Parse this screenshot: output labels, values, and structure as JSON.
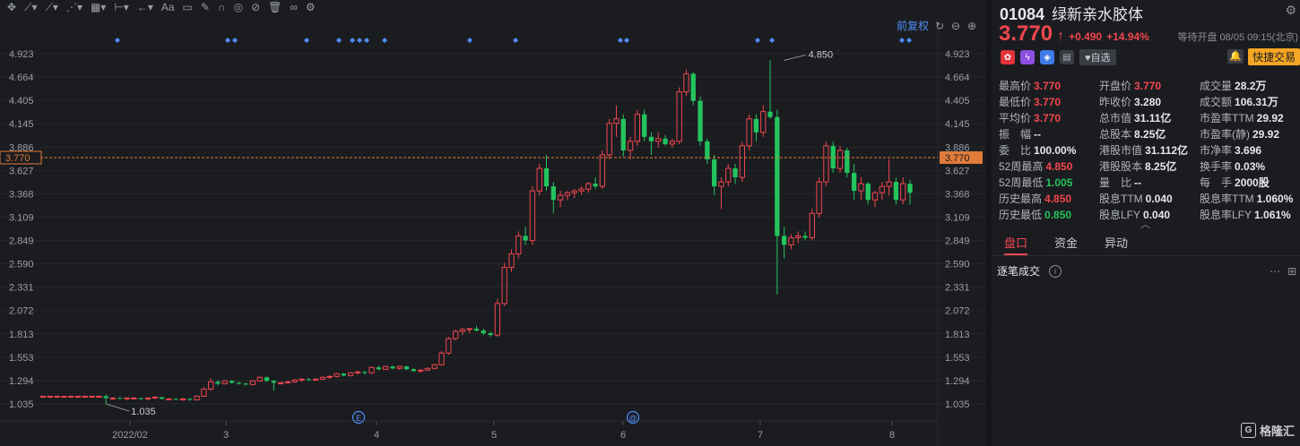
{
  "toolbar": {
    "tools": [
      "cursor-crosshair-icon",
      "line-tool-icon",
      "trend-tool-icon",
      "channel-tool-icon",
      "measure-tool-icon",
      "range-tool-icon",
      "arrow-tool-icon",
      "text-tool-icon",
      "note-tool-icon",
      "pen-tool-icon",
      "magnet-tool-icon",
      "visibility-tool-icon",
      "hide-tool-icon",
      "trash-tool-icon",
      "link-tool-icon",
      "settings-tool-icon"
    ],
    "text_tool_label": "Aa"
  },
  "chart_controls": {
    "adjust_label": "前复权"
  },
  "chart_data": {
    "type": "candlestick",
    "y_ticks": [
      "4.923",
      "4.664",
      "4.405",
      "4.145",
      "3.886",
      "3.627",
      "3.368",
      "3.109",
      "2.849",
      "2.590",
      "2.331",
      "2.072",
      "1.813",
      "1.553",
      "1.294",
      "1.035"
    ],
    "ylim": [
      1.035,
      4.923
    ],
    "x_ticks": [
      "2022/02",
      "3",
      "4",
      "5",
      "6",
      "7",
      "8"
    ],
    "current_price_label": "3.770",
    "high_annotation": "4.850",
    "low_annotation": "1.035",
    "event_markers": [
      "E",
      "@"
    ],
    "candles": [
      [
        1.12,
        1.12,
        1.11,
        1.12
      ],
      [
        1.12,
        1.12,
        1.11,
        1.12
      ],
      [
        1.12,
        1.12,
        1.11,
        1.12
      ],
      [
        1.12,
        1.12,
        1.11,
        1.12
      ],
      [
        1.12,
        1.12,
        1.11,
        1.12
      ],
      [
        1.12,
        1.12,
        1.11,
        1.12
      ],
      [
        1.12,
        1.12,
        1.11,
        1.12
      ],
      [
        1.12,
        1.12,
        1.11,
        1.12
      ],
      [
        1.12,
        1.12,
        1.11,
        1.12
      ],
      [
        1.12,
        1.14,
        1.035,
        1.1
      ],
      [
        1.1,
        1.11,
        1.08,
        1.1
      ],
      [
        1.1,
        1.11,
        1.09,
        1.09
      ],
      [
        1.09,
        1.11,
        1.08,
        1.1
      ],
      [
        1.1,
        1.11,
        1.09,
        1.1
      ],
      [
        1.1,
        1.1,
        1.08,
        1.09
      ],
      [
        1.09,
        1.11,
        1.08,
        1.1
      ],
      [
        1.1,
        1.12,
        1.09,
        1.11
      ],
      [
        1.11,
        1.11,
        1.09,
        1.09
      ],
      [
        1.09,
        1.1,
        1.08,
        1.09
      ],
      [
        1.09,
        1.1,
        1.08,
        1.08
      ],
      [
        1.08,
        1.1,
        1.07,
        1.09
      ],
      [
        1.09,
        1.1,
        1.07,
        1.08
      ],
      [
        1.08,
        1.13,
        1.08,
        1.12
      ],
      [
        1.12,
        1.22,
        1.11,
        1.2
      ],
      [
        1.2,
        1.32,
        1.18,
        1.28
      ],
      [
        1.28,
        1.3,
        1.24,
        1.26
      ],
      [
        1.26,
        1.3,
        1.25,
        1.29
      ],
      [
        1.29,
        1.3,
        1.26,
        1.27
      ],
      [
        1.27,
        1.28,
        1.25,
        1.26
      ],
      [
        1.26,
        1.27,
        1.24,
        1.25
      ],
      [
        1.25,
        1.3,
        1.25,
        1.29
      ],
      [
        1.29,
        1.34,
        1.28,
        1.33
      ],
      [
        1.33,
        1.34,
        1.28,
        1.29
      ],
      [
        1.29,
        1.3,
        1.18,
        1.27
      ],
      [
        1.27,
        1.28,
        1.25,
        1.27
      ],
      [
        1.27,
        1.29,
        1.26,
        1.28
      ],
      [
        1.28,
        1.31,
        1.27,
        1.3
      ],
      [
        1.3,
        1.32,
        1.28,
        1.31
      ],
      [
        1.31,
        1.32,
        1.29,
        1.3
      ],
      [
        1.3,
        1.32,
        1.29,
        1.31
      ],
      [
        1.31,
        1.34,
        1.3,
        1.33
      ],
      [
        1.33,
        1.35,
        1.31,
        1.34
      ],
      [
        1.34,
        1.38,
        1.33,
        1.37
      ],
      [
        1.37,
        1.38,
        1.34,
        1.35
      ],
      [
        1.35,
        1.39,
        1.34,
        1.38
      ],
      [
        1.38,
        1.4,
        1.36,
        1.39
      ],
      [
        1.39,
        1.4,
        1.36,
        1.38
      ],
      [
        1.38,
        1.45,
        1.37,
        1.44
      ],
      [
        1.44,
        1.46,
        1.41,
        1.42
      ],
      [
        1.42,
        1.46,
        1.41,
        1.45
      ],
      [
        1.45,
        1.46,
        1.42,
        1.43
      ],
      [
        1.43,
        1.46,
        1.41,
        1.45
      ],
      [
        1.45,
        1.46,
        1.41,
        1.42
      ],
      [
        1.42,
        1.43,
        1.39,
        1.4
      ],
      [
        1.4,
        1.42,
        1.38,
        1.41
      ],
      [
        1.41,
        1.44,
        1.4,
        1.43
      ],
      [
        1.43,
        1.48,
        1.42,
        1.47
      ],
      [
        1.47,
        1.62,
        1.46,
        1.6
      ],
      [
        1.6,
        1.78,
        1.58,
        1.76
      ],
      [
        1.76,
        1.86,
        1.74,
        1.84
      ],
      [
        1.84,
        1.88,
        1.8,
        1.86
      ],
      [
        1.86,
        1.88,
        1.82,
        1.87
      ],
      [
        1.87,
        1.9,
        1.84,
        1.85
      ],
      [
        1.85,
        1.87,
        1.8,
        1.82
      ],
      [
        1.82,
        1.84,
        1.78,
        1.8
      ],
      [
        1.8,
        2.2,
        1.78,
        2.15
      ],
      [
        2.15,
        2.6,
        2.12,
        2.55
      ],
      [
        2.55,
        2.75,
        2.5,
        2.7
      ],
      [
        2.7,
        2.95,
        2.65,
        2.9
      ],
      [
        2.9,
        3.0,
        2.8,
        2.85
      ],
      [
        2.85,
        3.45,
        2.8,
        3.4
      ],
      [
        3.4,
        3.7,
        3.35,
        3.65
      ],
      [
        3.65,
        3.8,
        3.4,
        3.45
      ],
      [
        3.45,
        3.5,
        3.15,
        3.3
      ],
      [
        3.3,
        3.4,
        3.22,
        3.35
      ],
      [
        3.35,
        3.4,
        3.3,
        3.38
      ],
      [
        3.38,
        3.42,
        3.32,
        3.4
      ],
      [
        3.4,
        3.45,
        3.36,
        3.42
      ],
      [
        3.42,
        3.5,
        3.38,
        3.48
      ],
      [
        3.48,
        3.55,
        3.42,
        3.45
      ],
      [
        3.45,
        3.85,
        3.42,
        3.8
      ],
      [
        3.8,
        4.2,
        3.75,
        4.15
      ],
      [
        4.15,
        4.35,
        4.0,
        4.2
      ],
      [
        4.2,
        4.25,
        3.78,
        3.85
      ],
      [
        3.85,
        4.0,
        3.75,
        3.95
      ],
      [
        3.95,
        4.3,
        3.9,
        4.25
      ],
      [
        4.25,
        4.3,
        3.95,
        4.0
      ],
      [
        4.0,
        4.05,
        3.8,
        3.95
      ],
      [
        3.95,
        4.05,
        3.88,
        3.98
      ],
      [
        3.98,
        4.02,
        3.9,
        3.92
      ],
      [
        3.92,
        3.98,
        3.88,
        3.95
      ],
      [
        3.95,
        4.55,
        3.92,
        4.5
      ],
      [
        4.5,
        4.75,
        4.45,
        4.7
      ],
      [
        4.7,
        4.72,
        4.35,
        4.4
      ],
      [
        4.4,
        4.45,
        3.9,
        3.95
      ],
      [
        3.95,
        3.98,
        3.7,
        3.75
      ],
      [
        3.75,
        3.8,
        3.35,
        3.45
      ],
      [
        3.45,
        3.55,
        3.2,
        3.5
      ],
      [
        3.5,
        3.7,
        3.45,
        3.65
      ],
      [
        3.65,
        3.7,
        3.48,
        3.55
      ],
      [
        3.55,
        3.95,
        3.5,
        3.9
      ],
      [
        3.9,
        4.25,
        3.85,
        4.2
      ],
      [
        4.2,
        4.25,
        3.95,
        4.05
      ],
      [
        4.05,
        4.35,
        4.0,
        4.28
      ],
      [
        4.28,
        4.85,
        4.2,
        4.22
      ],
      [
        4.22,
        4.3,
        2.25,
        2.9
      ],
      [
        2.9,
        3.0,
        2.65,
        2.8
      ],
      [
        2.8,
        2.92,
        2.75,
        2.88
      ],
      [
        2.88,
        2.95,
        2.82,
        2.9
      ],
      [
        2.9,
        2.95,
        2.85,
        2.88
      ],
      [
        2.88,
        3.2,
        2.85,
        3.15
      ],
      [
        3.15,
        3.55,
        3.1,
        3.5
      ],
      [
        3.5,
        3.95,
        3.45,
        3.9
      ],
      [
        3.9,
        3.95,
        3.6,
        3.65
      ],
      [
        3.65,
        3.9,
        3.6,
        3.85
      ],
      [
        3.85,
        3.88,
        3.55,
        3.6
      ],
      [
        3.6,
        3.7,
        3.3,
        3.4
      ],
      [
        3.4,
        3.55,
        3.3,
        3.48
      ],
      [
        3.48,
        3.5,
        3.25,
        3.3
      ],
      [
        3.3,
        3.4,
        3.22,
        3.38
      ],
      [
        3.38,
        3.5,
        3.3,
        3.45
      ],
      [
        3.45,
        3.75,
        3.35,
        3.5
      ],
      [
        3.5,
        3.55,
        3.25,
        3.3
      ],
      [
        3.3,
        3.55,
        3.25,
        3.48
      ],
      [
        3.48,
        3.52,
        3.25,
        3.38
      ]
    ]
  },
  "quote": {
    "code": "01084",
    "name": "绿新亲水胶体",
    "price": "3.770",
    "change": "+0.490",
    "change_pct": "+14.94%",
    "status": "等待开盘 08/05 09:15(北京)",
    "watch_label": "♥自选",
    "trade_label": "快捷交易",
    "stats": [
      {
        "label": "最高价",
        "value": "3.770",
        "color": "red"
      },
      {
        "label": "开盘价",
        "value": "3.770",
        "color": "red"
      },
      {
        "label": "成交量",
        "value": "28.2万",
        "color": ""
      },
      {
        "label": "最低价",
        "value": "3.770",
        "color": "red"
      },
      {
        "label": "昨收价",
        "value": "3.280",
        "color": ""
      },
      {
        "label": "成交额",
        "value": "106.31万",
        "color": ""
      },
      {
        "label": "平均价",
        "value": "3.770",
        "color": "red"
      },
      {
        "label": "总市值",
        "value": "31.11亿",
        "color": ""
      },
      {
        "label": "市盈率TTM",
        "value": "29.92",
        "color": ""
      },
      {
        "label": "振　幅",
        "value": "--",
        "color": ""
      },
      {
        "label": "总股本",
        "value": "8.25亿",
        "color": ""
      },
      {
        "label": "市盈率(静)",
        "value": "29.92",
        "color": ""
      },
      {
        "label": "委　比",
        "value": "100.00%",
        "color": ""
      },
      {
        "label": "港股市值",
        "value": "31.112亿",
        "color": ""
      },
      {
        "label": "市净率",
        "value": "3.696",
        "color": ""
      },
      {
        "label": "52周最高",
        "value": "4.850",
        "color": "red"
      },
      {
        "label": "港股股本",
        "value": "8.25亿",
        "color": ""
      },
      {
        "label": "换手率",
        "value": "0.03%",
        "color": ""
      },
      {
        "label": "52周最低",
        "value": "1.005",
        "color": "green"
      },
      {
        "label": "量　比",
        "value": "--",
        "color": ""
      },
      {
        "label": "每　手",
        "value": "2000股",
        "color": ""
      },
      {
        "label": "历史最高",
        "value": "4.850",
        "color": "red"
      },
      {
        "label": "股息TTM",
        "value": "0.040",
        "color": ""
      },
      {
        "label": "股息率TTM",
        "value": "1.060%",
        "color": ""
      },
      {
        "label": "历史最低",
        "value": "0.850",
        "color": "green"
      },
      {
        "label": "股息LFY",
        "value": "0.040",
        "color": ""
      },
      {
        "label": "股息率LFY",
        "value": "1.061%",
        "color": ""
      }
    ],
    "tabs": [
      "盘口",
      "资金",
      "异动"
    ],
    "tick_title": "逐笔成交"
  },
  "brand": "格隆汇",
  "colors": {
    "up": "#f0474f",
    "down": "#23c45e",
    "accent": "#4e8ef7",
    "trade": "#f5a623"
  }
}
